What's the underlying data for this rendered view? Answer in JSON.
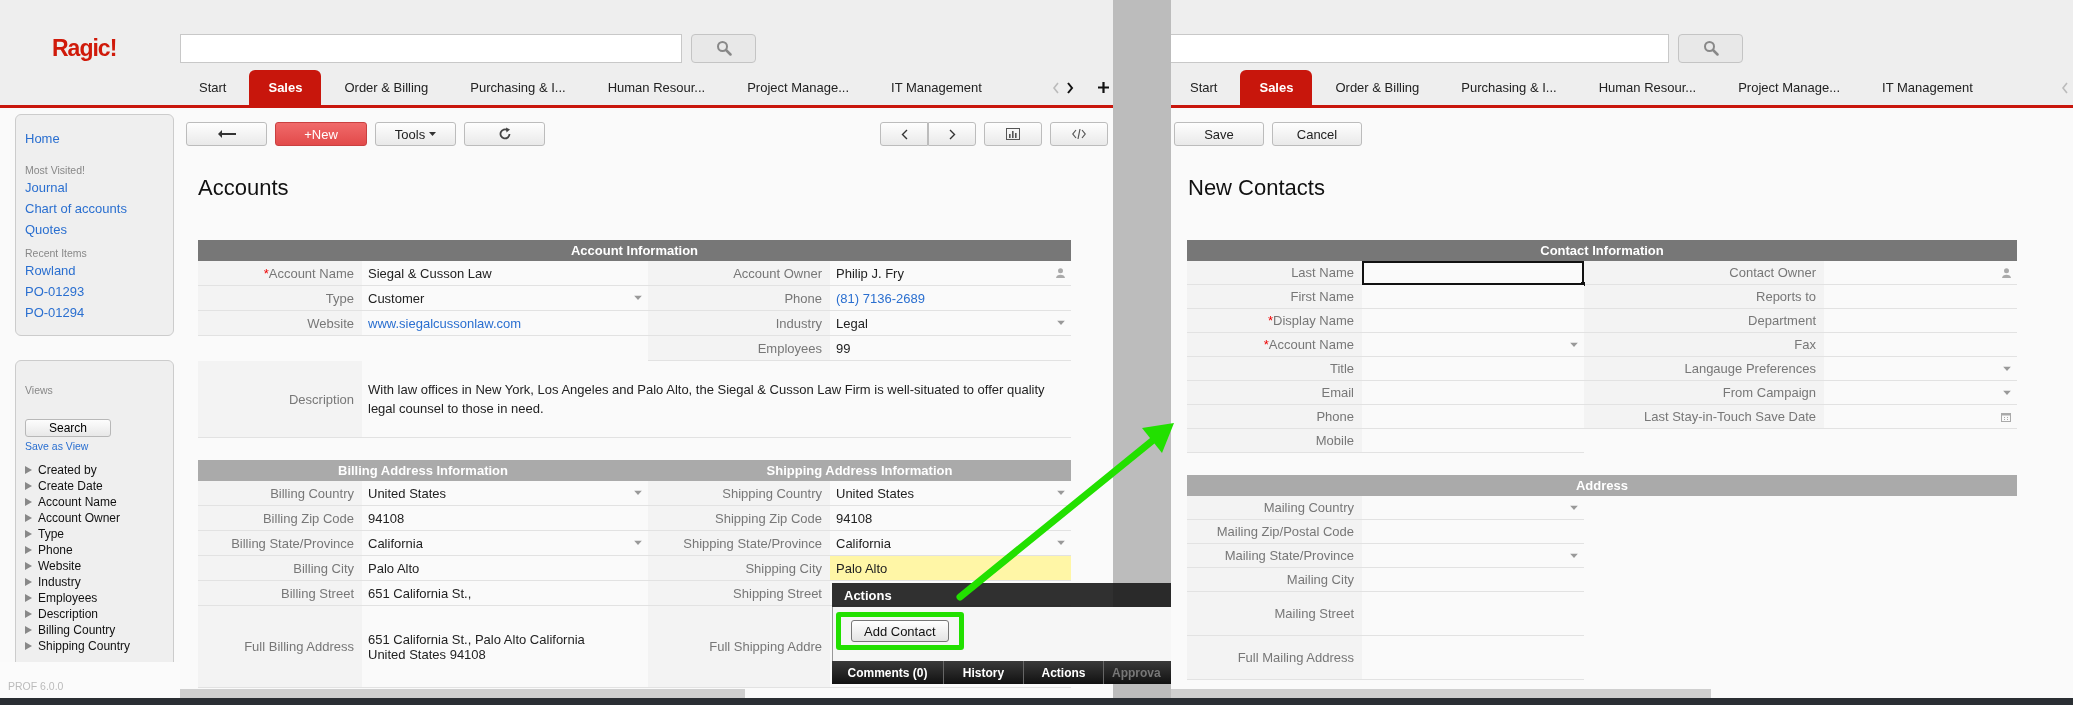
{
  "left_window": {
    "logo": "Ragic!",
    "tabs": [
      {
        "label": "Start",
        "selected": false
      },
      {
        "label": "Sales",
        "selected": true
      },
      {
        "label": "Order & Billing",
        "selected": false
      },
      {
        "label": "Purchasing & I...",
        "selected": false
      },
      {
        "label": "Human Resour...",
        "selected": false
      },
      {
        "label": "Project Manage...",
        "selected": false
      },
      {
        "label": "IT Management",
        "selected": false
      }
    ],
    "sidebar": {
      "home": "Home",
      "most_visited_heading": "Most Visited!",
      "most_visited": [
        "Journal",
        "Chart of accounts",
        "Quotes"
      ],
      "recent_heading": "Recent Items",
      "recent": [
        "Rowland",
        "PO-01293",
        "PO-01294"
      ],
      "views_heading": "Views",
      "search_button": "Search",
      "save_link": "Save as View",
      "fields": [
        "Created by",
        "Create Date",
        "Account Name",
        "Account Owner",
        "Type",
        "Phone",
        "Website",
        "Industry",
        "Employees",
        "Description",
        "Billing Country",
        "Shipping Country"
      ]
    },
    "toolbar": {
      "new_button": "+New",
      "tools_button": "Tools"
    },
    "form": {
      "title": "Accounts",
      "sections": [
        {
          "titles": [
            "Account Information"
          ],
          "kind": "primary",
          "rows": [
            {
              "kind": "pair",
              "left": {
                "mark": "*",
                "label": "Account Name",
                "value": "Siegal & Cusson Law",
                "kind": "text"
              },
              "right": {
                "label": "Account Owner",
                "value": "Philip J. Fry",
                "kind": "user"
              }
            },
            {
              "kind": "pair",
              "left": {
                "label": "Type",
                "value": "Customer",
                "kind": "select"
              },
              "right": {
                "label": "Phone",
                "value": "(81) 7136-2689",
                "kind": "link"
              }
            },
            {
              "kind": "pair",
              "left": {
                "label": "Website",
                "value": "www.siegalcussonlaw.com",
                "kind": "link"
              },
              "right": {
                "label": "Industry",
                "value": "Legal",
                "kind": "select"
              }
            },
            {
              "kind": "pair",
              "right": {
                "label": "Employees",
                "value": "99",
                "kind": "text"
              }
            },
            {
              "kind": "wide",
              "left": {
                "label": "Description",
                "value": "With law offices in New York, Los Angeles and Palo Alto, the Siegal & Cusson Law Firm is well-situated to offer quality legal counsel to those in need.",
                "kind": "text"
              }
            }
          ]
        },
        {
          "titles": [
            "Billing Address Information",
            "Shipping Address Information"
          ],
          "kind": "secondary",
          "rows": [
            {
              "kind": "pair",
              "left": {
                "label": "Billing Country",
                "value": "United States",
                "kind": "select",
                "highlighted": false
              },
              "right": {
                "label": "Shipping Country",
                "value": "United States",
                "kind": "select",
                "highlighted": false
              }
            },
            {
              "kind": "pair",
              "left": {
                "label": "Billing Zip Code",
                "value": "94108",
                "kind": "text",
                "highlighted": false
              },
              "right": {
                "label": "Shipping Zip Code",
                "value": "94108",
                "kind": "text",
                "highlighted": false
              }
            },
            {
              "kind": "pair",
              "left": {
                "label": "Billing State/Province",
                "value": "California",
                "kind": "select",
                "highlighted": false
              },
              "right": {
                "label": "Shipping State/Province",
                "value": "California",
                "kind": "select",
                "highlighted": false
              }
            },
            {
              "kind": "pair",
              "left": {
                "label": "Billing City",
                "value": "Palo Alto",
                "kind": "text",
                "highlighted": false
              },
              "right": {
                "label": "Shipping City",
                "value": "Palo Alto",
                "kind": "text",
                "highlighted": true
              }
            },
            {
              "kind": "pair",
              "left": {
                "label": "Billing Street",
                "value": "651 California St.,",
                "kind": "text",
                "highlighted": false
              },
              "right": {
                "label": "Shipping Street",
                "kind": "text",
                "highlighted": false
              }
            },
            {
              "kind": "tall",
              "left": {
                "label": "Full Billing Address",
                "value": "651 California St., Palo Alto California United States 94108",
                "kind": "text",
                "highlighted": false
              },
              "right": {
                "label": "Full Shipping Addre",
                "kind": "text",
                "highlighted": false
              }
            }
          ]
        }
      ]
    },
    "version": "PROF 6.0.0"
  },
  "right_window": {
    "tabs": [
      {
        "label": "Start",
        "selected": false
      },
      {
        "label": "Sales",
        "selected": true
      },
      {
        "label": "Order & Billing",
        "selected": false
      },
      {
        "label": "Purchasing & I...",
        "selected": false
      },
      {
        "label": "Human Resour...",
        "selected": false
      },
      {
        "label": "Project Manage...",
        "selected": false
      },
      {
        "label": "IT Management",
        "selected": false
      }
    ],
    "toolbar": {
      "save_button": "Save",
      "cancel_button": "Cancel"
    },
    "form": {
      "title": "New Contacts",
      "sections": [
        {
          "titles": [
            "Contact Information"
          ],
          "kind": "primary",
          "rows": [
            {
              "kind": "pair",
              "left": {
                "label": "Last Name",
                "kind": "text",
                "focused": true
              },
              "right": {
                "label": "Contact Owner",
                "kind": "user",
                "focused": false
              }
            },
            {
              "kind": "pair",
              "left": {
                "label": "First Name",
                "kind": "text",
                "focused": false
              },
              "right": {
                "label": "Reports to",
                "kind": "text",
                "focused": false
              }
            },
            {
              "kind": "pair",
              "left": {
                "mark": "*",
                "label": "Display Name",
                "kind": "text",
                "focused": false
              },
              "right": {
                "label": "Department",
                "kind": "text",
                "focused": false
              }
            },
            {
              "kind": "pair",
              "left": {
                "mark": "*",
                "label": "Account Name",
                "kind": "select",
                "focused": false
              },
              "right": {
                "label": "Fax",
                "kind": "text",
                "focused": false
              }
            },
            {
              "kind": "pair",
              "left": {
                "label": "Title",
                "kind": "text",
                "focused": false
              },
              "right": {
                "label": "Langauge Preferences",
                "kind": "select",
                "focused": false
              }
            },
            {
              "kind": "pair",
              "left": {
                "label": "Email",
                "kind": "text",
                "focused": false
              },
              "right": {
                "label": "From Campaign",
                "kind": "select",
                "focused": false
              }
            },
            {
              "kind": "pair",
              "left": {
                "label": "Phone",
                "kind": "text",
                "focused": false
              },
              "right": {
                "label": "Last Stay-in-Touch Save Date",
                "kind": "date",
                "focused": false
              }
            },
            {
              "kind": "pair",
              "left": {
                "label": "Mobile",
                "kind": "text",
                "focused": false
              }
            }
          ]
        },
        {
          "titles": [
            "Address"
          ],
          "kind": "secondary",
          "rows": [
            {
              "kind": "pair",
              "left": {
                "label": "Mailing Country",
                "kind": "select",
                "focused": false
              }
            },
            {
              "kind": "pair",
              "left": {
                "label": "Mailing Zip/Postal Code",
                "kind": "text",
                "focused": false
              }
            },
            {
              "kind": "pair",
              "left": {
                "label": "Mailing State/Province",
                "kind": "select",
                "focused": false
              }
            },
            {
              "kind": "pair",
              "left": {
                "label": "Mailing City",
                "kind": "text",
                "focused": false
              }
            },
            {
              "kind": "tall",
              "left": {
                "label": "Mailing Street",
                "kind": "text",
                "focused": false
              }
            },
            {
              "kind": "tall",
              "left": {
                "label": "Full Mailing Address",
                "kind": "text",
                "focused": false
              }
            }
          ]
        }
      ]
    }
  },
  "actions_popup": {
    "title": "Actions",
    "button": "Add Contact",
    "tabs": [
      {
        "label": "Comments (0)",
        "disabled": false
      },
      {
        "label": "History",
        "disabled": false
      },
      {
        "label": "Actions",
        "disabled": false
      },
      {
        "label": "Approva",
        "disabled": true
      }
    ]
  }
}
